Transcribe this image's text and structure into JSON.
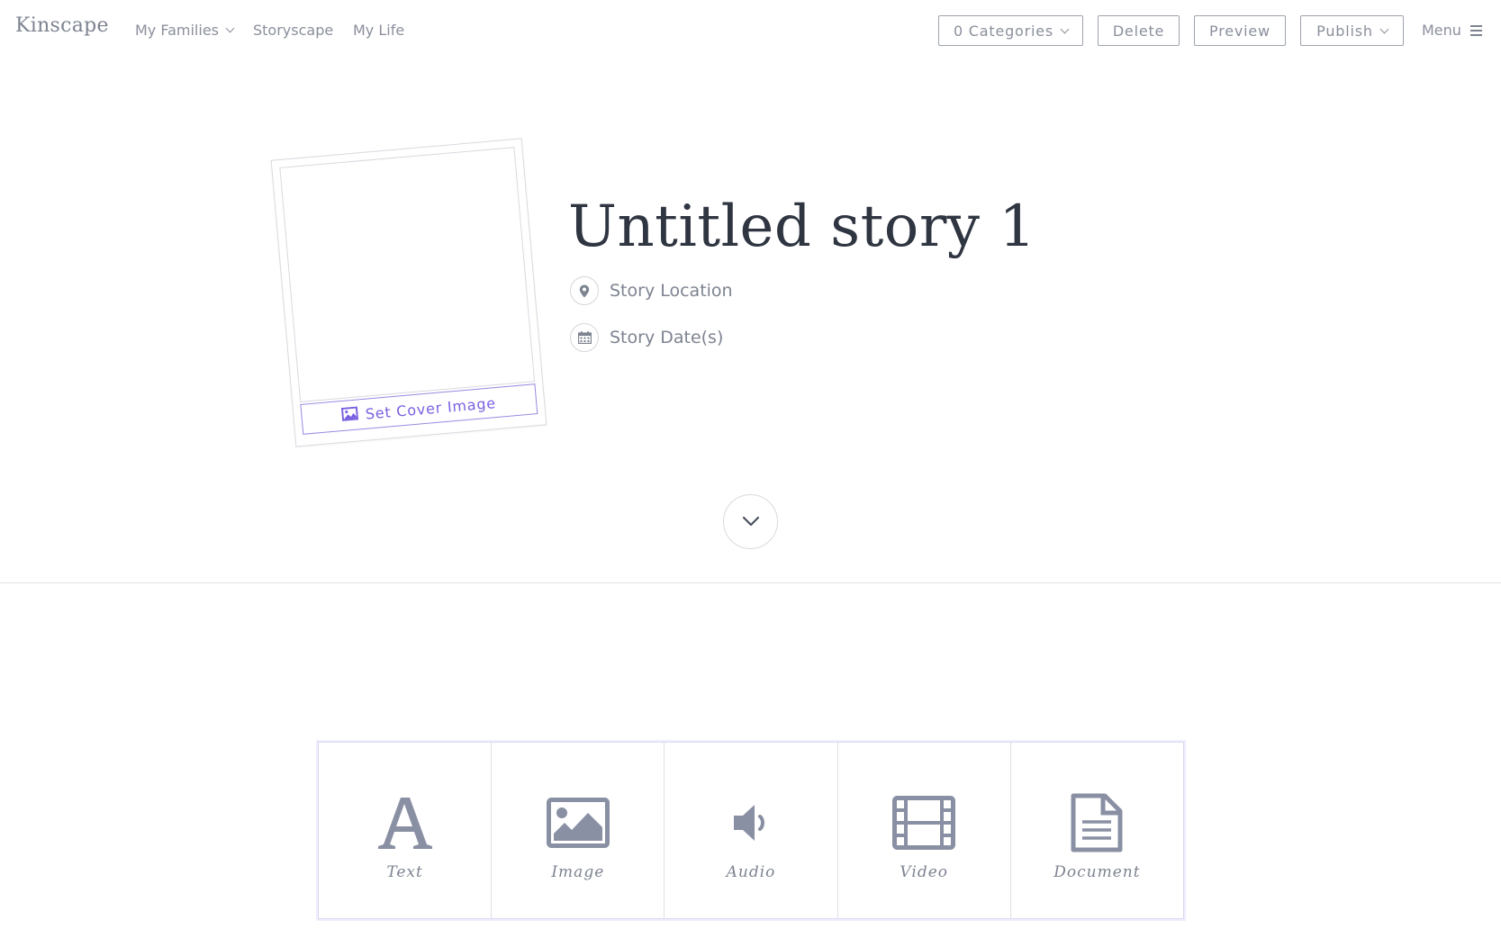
{
  "header": {
    "logo": "Kinscape",
    "nav": {
      "my_families": "My Families",
      "storyscape": "Storyscape",
      "my_life": "My Life"
    },
    "buttons": {
      "categories": "0 Categories",
      "delete": "Delete",
      "preview": "Preview",
      "publish": "Publish"
    },
    "menu": "Menu"
  },
  "story": {
    "title": "Untitled story 1",
    "location_placeholder": "Story Location",
    "date_placeholder": "Story Date(s)",
    "cover_button": "Set Cover Image"
  },
  "content_types": [
    {
      "label": "Text",
      "icon": "text-icon"
    },
    {
      "label": "Image",
      "icon": "image-icon"
    },
    {
      "label": "Audio",
      "icon": "audio-icon"
    },
    {
      "label": "Video",
      "icon": "video-icon"
    },
    {
      "label": "Document",
      "icon": "document-icon"
    }
  ],
  "colors": {
    "accent": "#7a5fe0",
    "icon_gray": "#8a90a3",
    "title": "#2f3541"
  }
}
